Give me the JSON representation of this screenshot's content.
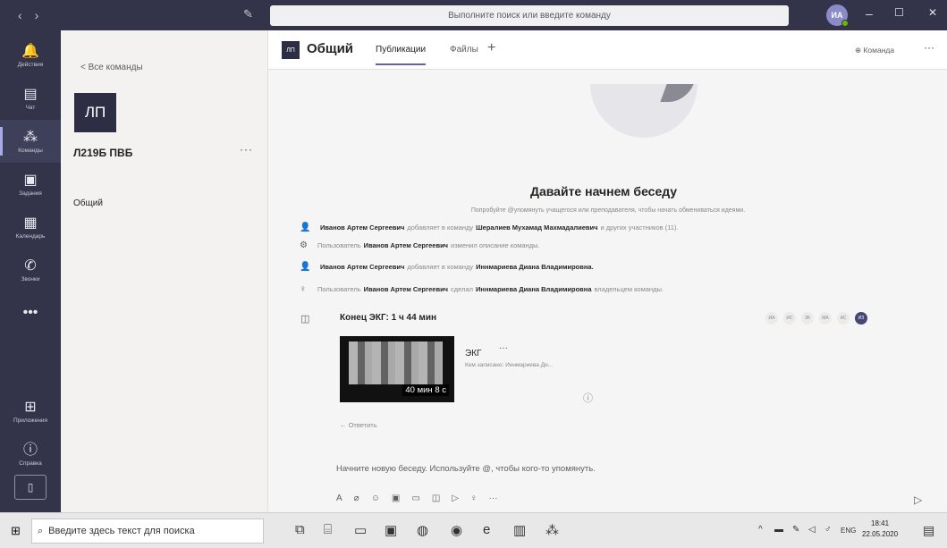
{
  "titlebar": {
    "search_placeholder": "Выполните поиск или введите команду",
    "user_initials": "ИА",
    "minimize": "–",
    "maximize": "☐",
    "close": "✕"
  },
  "rail": {
    "items": [
      {
        "label": "Действия",
        "icon": "bell-icon",
        "glyph": "🔔"
      },
      {
        "label": "Чат",
        "icon": "chat-icon",
        "glyph": "💬"
      },
      {
        "label": "Команды",
        "icon": "teams-icon",
        "glyph": "👥"
      },
      {
        "label": "Задания",
        "icon": "assignments-icon",
        "glyph": "🎒"
      },
      {
        "label": "Календарь",
        "icon": "calendar-icon",
        "glyph": "📅"
      },
      {
        "label": "Звонки",
        "icon": "phone-icon",
        "glyph": "📞"
      },
      {
        "label": "",
        "icon": "more-icon",
        "glyph": "•••"
      },
      {
        "label": "Приложения",
        "icon": "apps-icon",
        "glyph": "⊞"
      },
      {
        "label": "Справка",
        "icon": "help-icon",
        "glyph": "?"
      }
    ]
  },
  "teampanel": {
    "back_label": "< Все команды",
    "tile_initials": "ЛП",
    "team_name": "Л219Б ПВБ",
    "more": "···",
    "channel": "Общий"
  },
  "header": {
    "tile_initials": "ЛП",
    "channel_title": "Общий",
    "tabs": [
      "Публикации",
      "Файлы"
    ],
    "add_tab": "+",
    "team_button": "Команда",
    "more": "···"
  },
  "feed": {
    "start_title": "Давайте начнем беседу",
    "start_subtitle": "Попробуйте @упомянуть учащегося или преподавателя, чтобы начать обмениваться идеями.",
    "events": [
      {
        "icon": "add-member-icon",
        "glyph": "👤",
        "pre": "",
        "b1": "Иванов Артем Сергеевич",
        "mid": "добавляет в команду",
        "b2": "Шералиев Мухамад Махмадалиевич",
        "post": "и других участников (11)."
      },
      {
        "icon": "edit-team-icon",
        "glyph": "⚙",
        "pre": "Пользователь",
        "b1": "Иванов Артем Сергеевич",
        "mid": "изменил описание команды.",
        "b2": "",
        "post": ""
      },
      {
        "icon": "add-member-icon",
        "glyph": "👤",
        "pre": "",
        "b1": "Иванов Артем Сергеевич",
        "mid": "добавляет в команду",
        "b2": "Иннмариева Диана Владимировна.",
        "post": ""
      },
      {
        "icon": "owner-icon",
        "glyph": "♀",
        "pre": "Пользователь",
        "b1": "Иванов Артем Сергеевич",
        "mid": "сделал",
        "b2": "Иннмариева Диана Владимировна",
        "post": "владельцем команды."
      }
    ],
    "meeting": {
      "title": "Конец ЭКГ: 1 ч 44 мин",
      "participants": [
        "ИА",
        "ИС",
        "ЗК",
        "МА",
        "АС",
        "ИЗ"
      ],
      "recording_name": "ЭКГ",
      "recording_by": "Кем записано: Иннмариева Ди...",
      "duration": "40 мин 8 с",
      "more": "···",
      "reply": "← Ответить"
    },
    "compose_placeholder": "Начните новую беседу. Используйте @, чтобы кого-то упомянуть.",
    "compose_tools": [
      "A",
      "📎",
      "☺",
      "GIF",
      "▭",
      "📹",
      "▷",
      "♀",
      "···"
    ],
    "send": "▷"
  },
  "taskbar": {
    "search_placeholder": "Введите здесь текст для поиска",
    "lang": "ENG",
    "time": "18:41",
    "date": "22.05.2020"
  }
}
